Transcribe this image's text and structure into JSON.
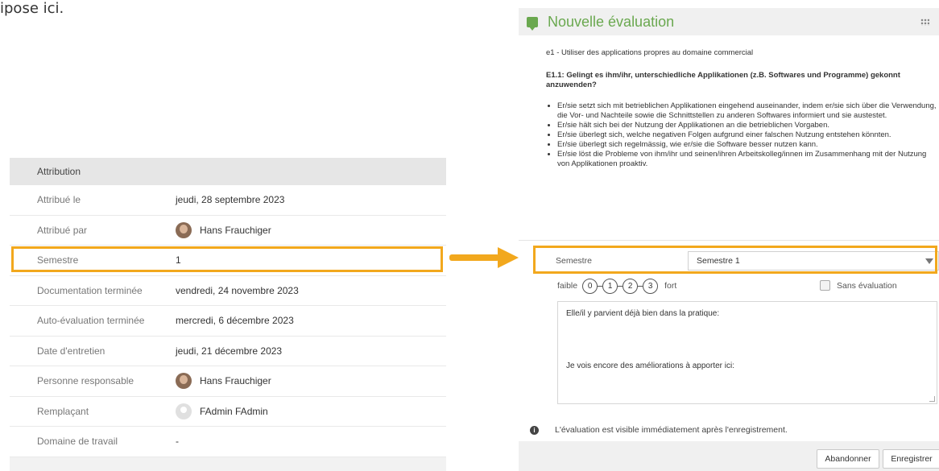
{
  "fragment_text": "ipose ici.",
  "left_panel": {
    "header": "Attribution",
    "rows": [
      {
        "label": "Attribué le",
        "value": "jeudi, 28 septembre 2023",
        "avatar": false
      },
      {
        "label": "Attribué par",
        "value": "Hans Frauchiger",
        "avatar": true
      },
      {
        "label": "Semestre",
        "value": "1",
        "avatar": false
      },
      {
        "label": "Documentation terminée",
        "value": "vendredi, 24 novembre 2023",
        "avatar": false
      },
      {
        "label": "Auto-évaluation terminée",
        "value": "mercredi, 6 décembre 2023",
        "avatar": false
      },
      {
        "label": "Date d'entretien",
        "value": "jeudi, 21 décembre 2023",
        "avatar": false
      },
      {
        "label": "Personne responsable",
        "value": "Hans Frauchiger",
        "avatar": true
      },
      {
        "label": "Remplaçant",
        "value": "FAdmin FAdmin",
        "avatar": true
      },
      {
        "label": "Domaine de travail",
        "value": "-",
        "avatar": false
      }
    ]
  },
  "right_panel": {
    "title": "Nouvelle évaluation",
    "subtitle": "e1 - Utiliser des applications propres au domaine commercial",
    "question": "E1.1: Gelingt es ihm/ihr, unterschiedliche Applikationen (z.B. Softwares und Programme) gekonnt anzuwenden?",
    "bullets": [
      "Er/sie setzt sich mit betrieblichen Applikationen eingehend auseinander, indem er/sie sich über die Verwendung, die Vor- und Nachteile sowie die Schnittstellen zu anderen Softwares informiert und sie austestet.",
      "Er/sie hält sich bei der Nutzung der Applikationen an die betrieblichen Vorgaben.",
      "Er/sie überlegt sich, welche negativen Folgen aufgrund einer falschen Nutzung entstehen könnten.",
      "Er/sie überlegt sich regelmässig, wie er/sie die Software besser nutzen kann.",
      "Er/sie löst die Probleme von ihm/ihr und seinen/ihren Arbeitskolleg/innen im Zusammenhang mit der Nutzung von Applikationen proaktiv."
    ],
    "semestre_label": "Semestre",
    "semestre_value": "Semestre 1",
    "rating": {
      "low": "faible",
      "high": "fort",
      "options": [
        "0",
        "1",
        "2",
        "3"
      ]
    },
    "sans_evaluation": "Sans évaluation",
    "textarea_line1": "Elle/il y parvient déjà bien dans la pratique:",
    "textarea_line2": "Je vois encore des améliorations à apporter ici:",
    "info": "L'évaluation est visible immédiatement après l'enregistrement.",
    "cancel_label": "Abandonner",
    "save_label": "Enregistrer"
  },
  "colors": {
    "accent": "#6aa84f",
    "highlight": "#f2a81d"
  }
}
